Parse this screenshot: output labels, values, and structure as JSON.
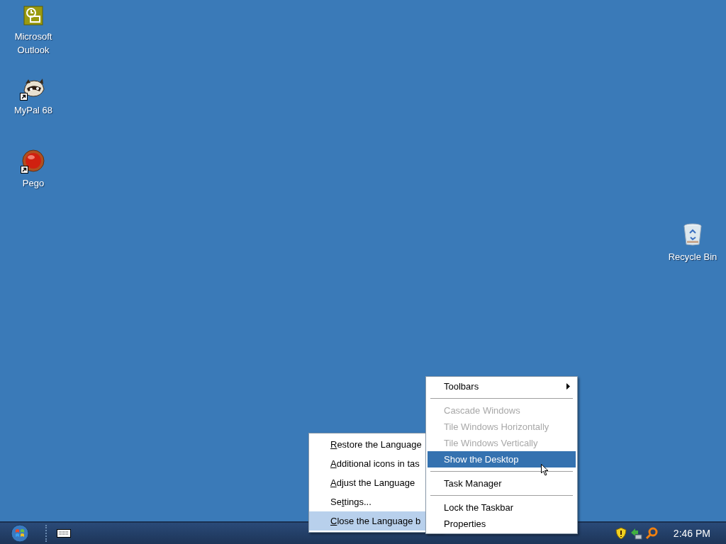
{
  "desktop_icons": [
    {
      "kind": "outlook",
      "label": "Microsoft Outlook",
      "shortcut": false
    },
    {
      "kind": "raccoon",
      "label": "MyPal 68",
      "shortcut": true
    },
    {
      "kind": "ball",
      "label": "Pego",
      "shortcut": true
    },
    {
      "kind": "bin",
      "label": "Recycle Bin",
      "shortcut": false
    }
  ],
  "language_menu": {
    "items": [
      {
        "key": "R",
        "post": "estore the Language",
        "selected": false
      },
      {
        "key": "A",
        "post": "dditional icons in tas",
        "selected": false
      },
      {
        "key": "A",
        "post": "djust the Language",
        "selected": false
      },
      {
        "pre": "Se",
        "key": "t",
        "post": "tings...",
        "selected": false
      },
      {
        "key": "C",
        "post": "lose the Language b",
        "selected": true
      }
    ]
  },
  "taskbar_menu": {
    "items": [
      {
        "kind": "submenu",
        "label": "Toolbars",
        "disabled": false,
        "selected": false
      },
      {
        "kind": "separator"
      },
      {
        "kind": "item",
        "label": "Cascade Windows",
        "disabled": true,
        "selected": false
      },
      {
        "kind": "item",
        "label": "Tile Windows Horizontally",
        "disabled": true,
        "selected": false
      },
      {
        "kind": "item",
        "label": "Tile Windows Vertically",
        "disabled": true,
        "selected": false
      },
      {
        "kind": "item",
        "label": "Show the Desktop",
        "disabled": false,
        "selected": true
      },
      {
        "kind": "separator"
      },
      {
        "kind": "item",
        "label": "Task Manager",
        "disabled": false,
        "selected": false
      },
      {
        "kind": "separator"
      },
      {
        "kind": "item",
        "label": "Lock the Taskbar",
        "disabled": false,
        "selected": false
      },
      {
        "kind": "item",
        "label": "Properties",
        "disabled": false,
        "selected": false
      }
    ]
  },
  "taskbar": {
    "clock": "2:46 PM"
  }
}
